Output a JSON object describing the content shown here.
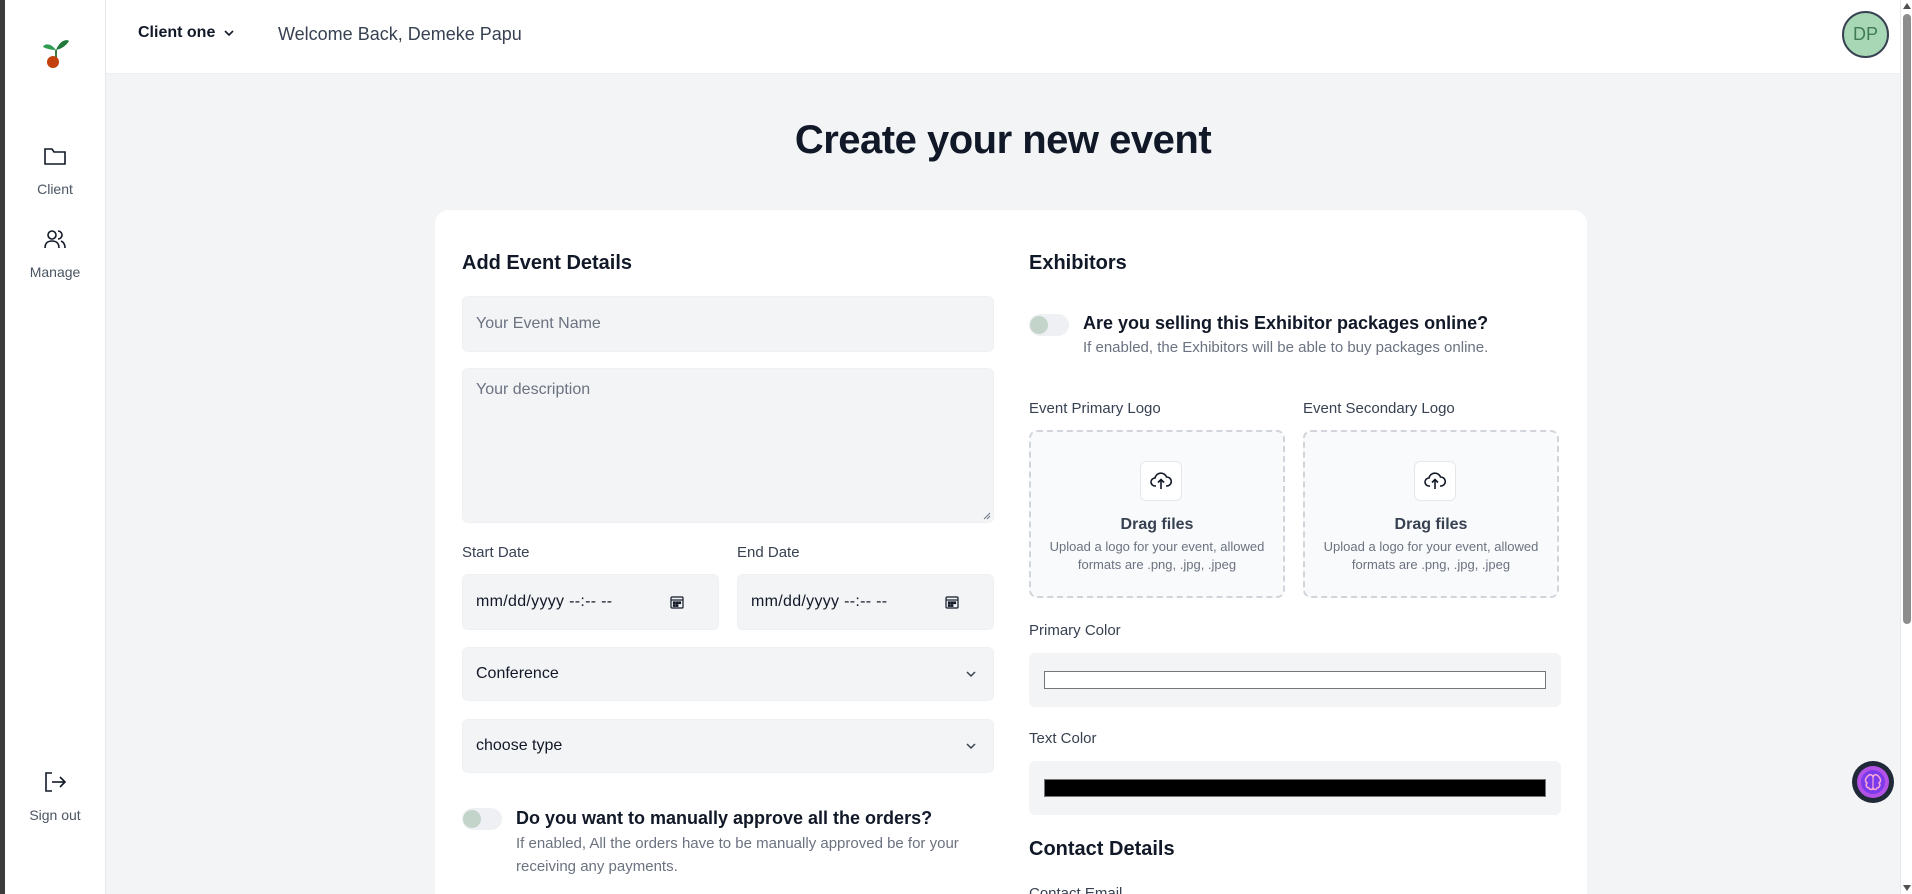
{
  "sidebar": {
    "items": [
      {
        "label": "Client",
        "icon": "folder-icon"
      },
      {
        "label": "Manage",
        "icon": "users-icon"
      }
    ],
    "signout_label": "Sign out"
  },
  "header": {
    "client_name": "Client one",
    "welcome": "Welcome Back, Demeke Papu",
    "avatar_initials": "DP"
  },
  "page": {
    "title": "Create your new event"
  },
  "event_details": {
    "heading": "Add Event Details",
    "name_placeholder": "Your Event Name",
    "description_placeholder": "Your description",
    "start_date_label": "Start Date",
    "start_date_value": "mm/dd/yyyy --:-- --",
    "end_date_label": "End Date",
    "end_date_value": "mm/dd/yyyy --:-- --",
    "category_value": "Conference",
    "type_value": "choose type",
    "approve_title": "Do you want to manually approve all the orders?",
    "approve_desc": "If enabled, All the orders have to be manually approved be for your receiving any payments."
  },
  "exhibitors": {
    "heading": "Exhibitors",
    "selling_title": "Are you selling this Exhibitor packages online?",
    "selling_desc": "If enabled, the Exhibitors will be able to buy packages online.",
    "primary_logo_label": "Event Primary Logo",
    "secondary_logo_label": "Event Secondary Logo",
    "drag_title": "Drag files",
    "drag_desc": "Upload a logo for your event, allowed formats are .png, .jpg, .jpeg",
    "primary_color_label": "Primary Color",
    "primary_color_value": "#ffffff",
    "text_color_label": "Text Color",
    "text_color_value": "#000000"
  },
  "contact": {
    "heading": "Contact Details",
    "email_label": "Contact Email"
  },
  "colors": {
    "brand_green": "#2e9b4f",
    "avatar_bg": "#a7d7b5",
    "page_bg": "#f3f4f6"
  }
}
